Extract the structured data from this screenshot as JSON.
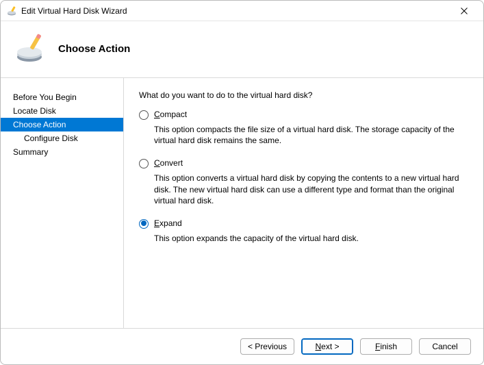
{
  "window": {
    "title": "Edit Virtual Hard Disk Wizard"
  },
  "header": {
    "title": "Choose Action"
  },
  "sidebar": {
    "steps": [
      {
        "label": "Before You Begin",
        "active": false,
        "indent": false
      },
      {
        "label": "Locate Disk",
        "active": false,
        "indent": false
      },
      {
        "label": "Choose Action",
        "active": true,
        "indent": false
      },
      {
        "label": "Configure Disk",
        "active": false,
        "indent": true
      },
      {
        "label": "Summary",
        "active": false,
        "indent": false
      }
    ]
  },
  "main": {
    "prompt": "What do you want to do to the virtual hard disk?",
    "options": [
      {
        "label": "Compact",
        "desc": "This option compacts the file size of a virtual hard disk. The storage capacity of the virtual hard disk remains the same.",
        "selected": false
      },
      {
        "label": "Convert",
        "desc": "This option converts a virtual hard disk by copying the contents to a new virtual hard disk. The new virtual hard disk can use a different type and format than the original virtual hard disk.",
        "selected": false
      },
      {
        "label": "Expand",
        "desc": "This option expands the capacity of the virtual hard disk.",
        "selected": true
      }
    ]
  },
  "footer": {
    "previous": "< Previous",
    "next": "Next >",
    "finish": "Finish",
    "cancel": "Cancel"
  }
}
